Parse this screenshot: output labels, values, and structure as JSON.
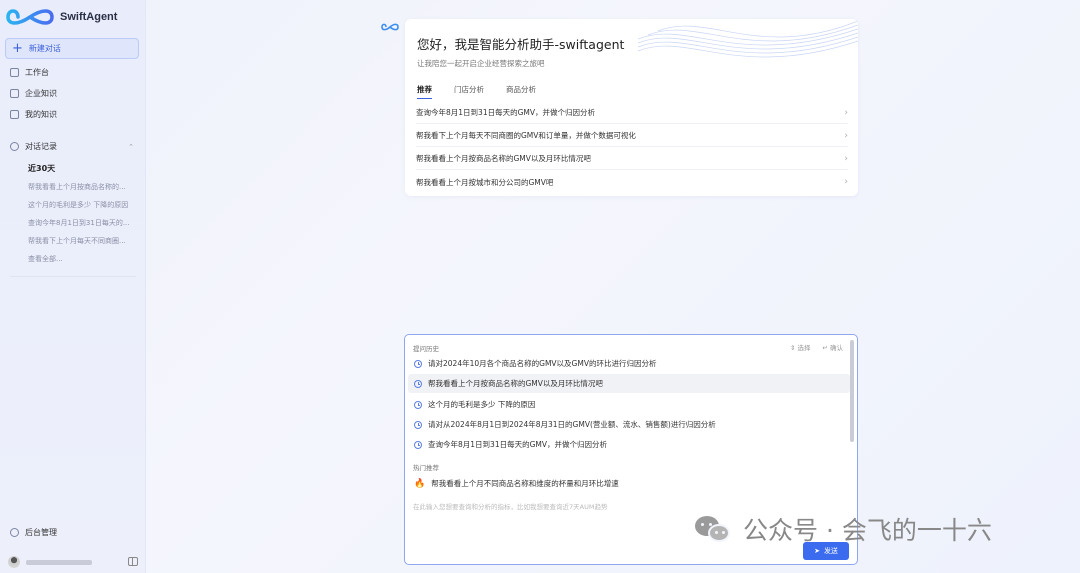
{
  "app": {
    "name": "SwiftAgent"
  },
  "sidebar": {
    "new_chat": "新建对话",
    "nav": [
      {
        "label": "工作台",
        "icon": "workspace-icon"
      },
      {
        "label": "企业知识",
        "icon": "book-icon"
      },
      {
        "label": "我的知识",
        "icon": "document-icon"
      }
    ],
    "history": {
      "title": "对话记录",
      "period": "近30天",
      "items": [
        "帮我看看上个月按商品名称的...",
        "这个月的毛利是多少 下降的原因",
        "查询今年8月1日到31日每天的...",
        "帮我看下上个月每天不同商圈...",
        "查看全部..."
      ]
    },
    "admin": "后台管理"
  },
  "welcome": {
    "title": "您好，我是智能分析助手-swiftagent",
    "subtitle": "让我陪您一起开启企业经营探索之旅吧",
    "tabs": [
      "推荐",
      "门店分析",
      "商品分析"
    ],
    "active_tab": "推荐",
    "questions": [
      "查询今年8月1日到31日每天的GMV，并做个归因分析",
      "帮我看下上个月每天不同商圈的GMV和订单量，并做个数据可视化",
      "帮我看看上个月按商品名称的GMV以及月环比情况吧",
      "帮我看看上个月按城市和分公司的GMV吧"
    ]
  },
  "input_panel": {
    "history_title": "提问历史",
    "select_label": "选择",
    "confirm_label": "确认",
    "history": [
      "请对2024年10月各个商品名称的GMV以及GMV的环比进行归因分析",
      "帮我看看上个月按商品名称的GMV以及月环比情况吧",
      "这个月的毛利是多少 下降的原因",
      "请对从2024年8月1日到2024年8月31日的GMV(营业额、流水、销售额)进行归因分析",
      "查询今年8月1日到31日每天的GMV，并做个归因分析"
    ],
    "selected_index": 1,
    "hot_title": "热门推荐",
    "hot": [
      "帮我看看上个月不同商品名称和维度的杯量和月环比增速"
    ],
    "placeholder": "在此输入您想要查询和分析的指标，比如我想要查询近7天AUM趋势",
    "send_label": "发送"
  },
  "watermark": {
    "text": "公众号 · 会飞的一十六"
  },
  "colors": {
    "accent": "#3b6cf0",
    "sidebar_bg": "#e9edfb",
    "selected_bg": "#dfe6fb"
  }
}
